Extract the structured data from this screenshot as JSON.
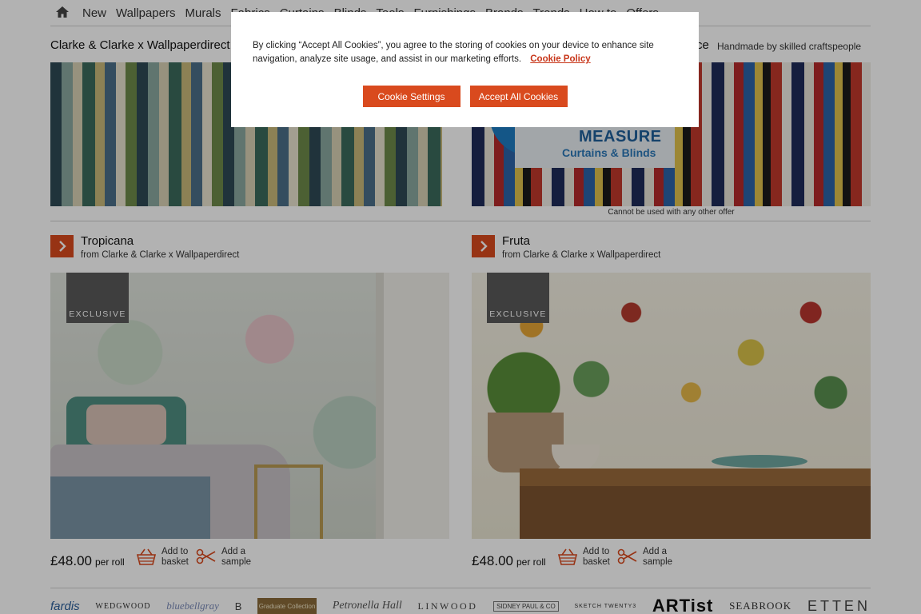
{
  "nav": {
    "items": [
      "New",
      "Wallpapers",
      "Murals",
      "Fabrics",
      "Curtains",
      "Blinds",
      "Tools",
      "Furnishings",
      "Brands",
      "Trends",
      "How to",
      "Offers"
    ]
  },
  "promos": {
    "left_title": "Clarke & Clarke x Wallpaperdirect",
    "right_title_fragment": "ce",
    "right_subtitle": "Handmade by skilled craftspeople",
    "banner_measure": "MEASURE",
    "banner_measure_sub": "Curtains & Blinds",
    "offer_note": "Cannot be used with any other offer"
  },
  "products": [
    {
      "name": "Tropicana",
      "from": "from Clarke & Clarke x Wallpaperdirect",
      "badge": "EXCLUSIVE",
      "price": "£48.00",
      "per": "per roll",
      "basket_l1": "Add to",
      "basket_l2": "basket",
      "sample_l1": "Add a",
      "sample_l2": "sample"
    },
    {
      "name": "Fruta",
      "from": "from Clarke & Clarke x Wallpaperdirect",
      "badge": "EXCLUSIVE",
      "price": "£48.00",
      "per": "per roll",
      "basket_l1": "Add to",
      "basket_l2": "basket",
      "sample_l1": "Add a",
      "sample_l2": "sample"
    }
  ],
  "brands": [
    "fardis",
    "WEDGWOOD",
    "bluebellgray",
    "B",
    "Graduate Collection",
    "Petronella Hall",
    "LINWOOD",
    "SIDNEY PAUL & CO",
    "SKETCH TWENTY3",
    "ARTist",
    "SEABROOK",
    "ETTEN"
  ],
  "cookie": {
    "text": "By clicking “Accept All Cookies”, you agree to the storing of cookies on your device to enhance site navigation, analyze site usage, and assist in our marketing efforts.",
    "link": "Cookie Policy",
    "settings_button": "Cookie Settings",
    "accept_button": "Accept All Cookies"
  },
  "colors": {
    "accent": "#d94a1e",
    "link": "#c8361a",
    "overlay": "rgba(0,0,0,0.3)"
  }
}
